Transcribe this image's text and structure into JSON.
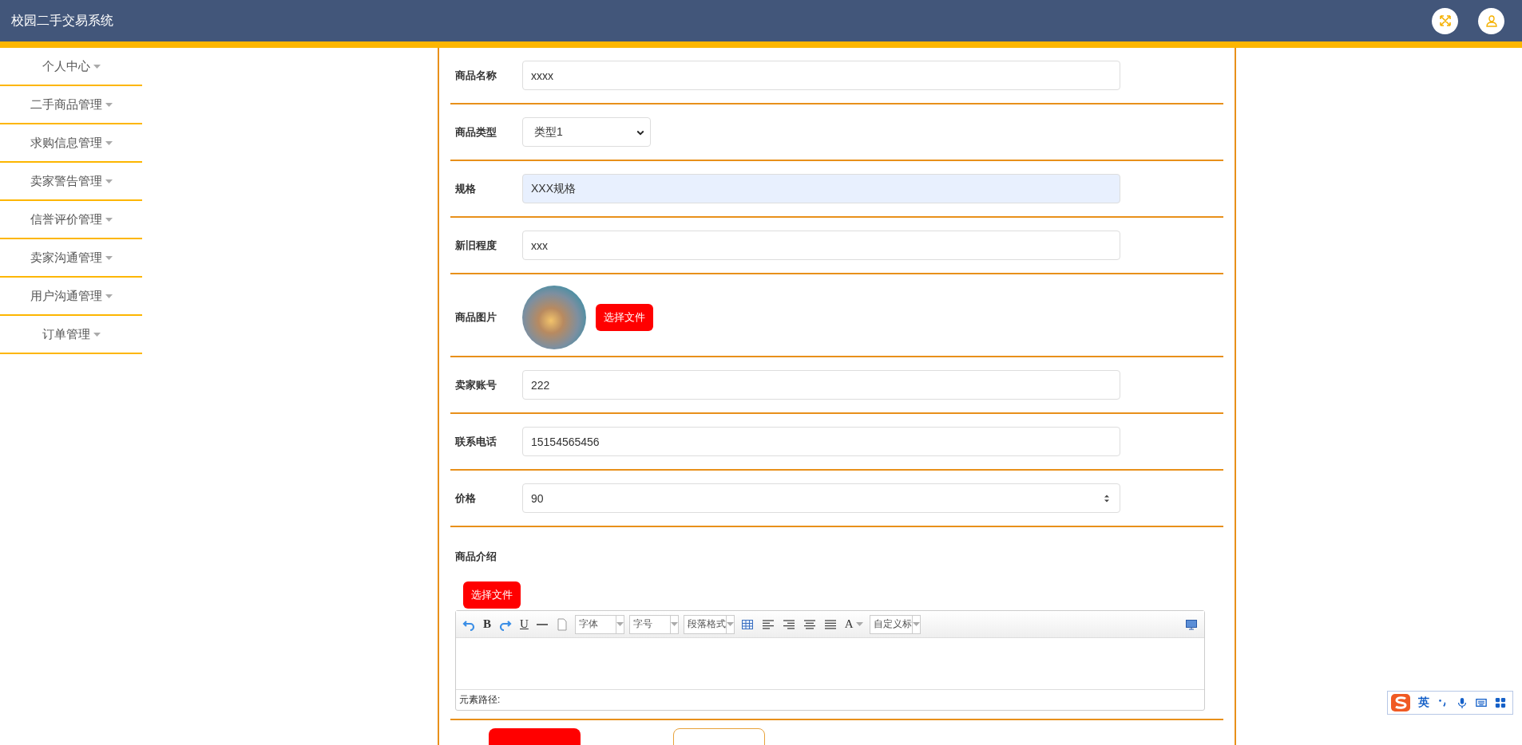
{
  "header": {
    "title": "校园二手交易系统"
  },
  "sidebar": {
    "items": [
      {
        "label": "个人中心"
      },
      {
        "label": "二手商品管理"
      },
      {
        "label": "求购信息管理"
      },
      {
        "label": "卖家警告管理"
      },
      {
        "label": "信誉评价管理"
      },
      {
        "label": "卖家沟通管理"
      },
      {
        "label": "用户沟通管理"
      },
      {
        "label": "订单管理"
      }
    ]
  },
  "form": {
    "fields": [
      {
        "kind": "text",
        "label": "商品名称",
        "value": "xxxx",
        "highlighted": false
      },
      {
        "kind": "select",
        "label": "商品类型",
        "value": "类型1"
      },
      {
        "kind": "text",
        "label": "规格",
        "value": "XXX规格",
        "highlighted": true
      },
      {
        "kind": "text",
        "label": "新旧程度",
        "value": "xxx",
        "highlighted": false
      },
      {
        "kind": "image",
        "label": "商品图片",
        "button": "选择文件"
      },
      {
        "kind": "text",
        "label": "卖家账号",
        "value": "222",
        "highlighted": false
      },
      {
        "kind": "text",
        "label": "联系电话",
        "value": "15154565456",
        "highlighted": false
      },
      {
        "kind": "number",
        "label": "价格",
        "value": "90"
      },
      {
        "kind": "editor",
        "label": "商品介绍",
        "button": "选择文件",
        "path_label": "元素路径:",
        "toolbar": [
          {
            "kind": "undo"
          },
          {
            "kind": "bold",
            "text": "B"
          },
          {
            "kind": "redo"
          },
          {
            "kind": "underline",
            "text": "U"
          },
          {
            "kind": "rule"
          },
          {
            "kind": "page"
          },
          {
            "kind": "dropdown",
            "text": "字体"
          },
          {
            "kind": "dropdown",
            "text": "字号"
          },
          {
            "kind": "dropdown",
            "text": "段落格式"
          },
          {
            "kind": "table"
          },
          {
            "kind": "align-left"
          },
          {
            "kind": "align-right"
          },
          {
            "kind": "align-center"
          },
          {
            "kind": "justify"
          },
          {
            "kind": "color",
            "text": "A"
          },
          {
            "kind": "dropdown",
            "text": "自定义标"
          }
        ]
      }
    ],
    "buttons": [
      {
        "kind": "primary"
      },
      {
        "kind": "outline"
      }
    ]
  },
  "ime": {
    "mode": "英"
  }
}
